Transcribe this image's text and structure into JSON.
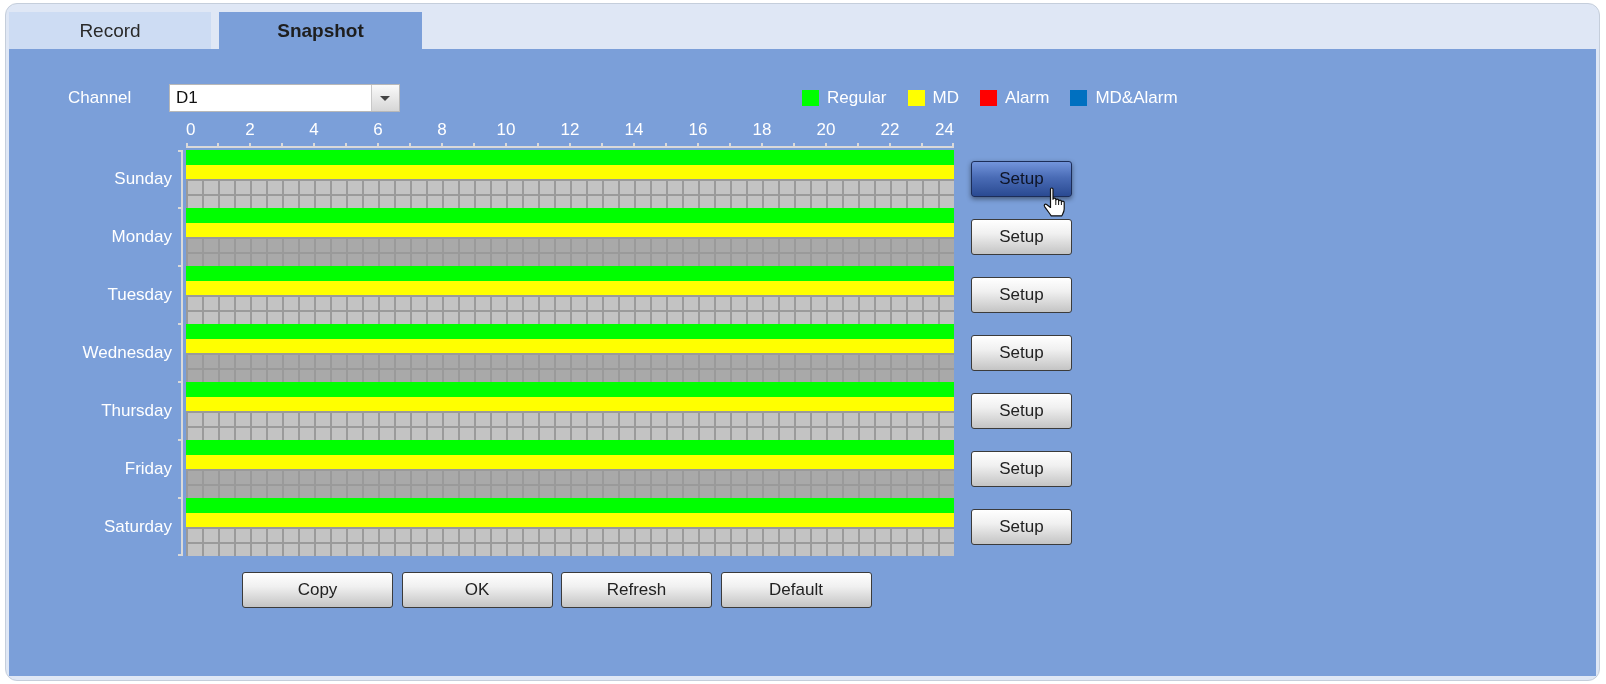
{
  "tabs": [
    {
      "label": "Record",
      "selected": false
    },
    {
      "label": "Snapshot",
      "selected": true
    }
  ],
  "channel": {
    "label": "Channel",
    "value": "D1"
  },
  "legend": [
    {
      "label": "Regular",
      "color": "#00ff00"
    },
    {
      "label": "MD",
      "color": "#ffff00"
    },
    {
      "label": "Alarm",
      "color": "#ff0000"
    },
    {
      "label": "MD&Alarm",
      "color": "#0070c0"
    }
  ],
  "hour_labels": [
    "0",
    "2",
    "4",
    "6",
    "8",
    "10",
    "12",
    "14",
    "16",
    "18",
    "20",
    "22",
    "24"
  ],
  "days": [
    {
      "name": "Sunday",
      "tracks": [
        {
          "on": true
        },
        {
          "on": true
        },
        {
          "on": false
        },
        {
          "on": false
        }
      ],
      "setup": {
        "label": "Setup",
        "hovered": true
      }
    },
    {
      "name": "Monday",
      "tracks": [
        {
          "on": true
        },
        {
          "on": true
        },
        {
          "on": false
        },
        {
          "on": false
        }
      ],
      "setup": {
        "label": "Setup",
        "hovered": false
      }
    },
    {
      "name": "Tuesday",
      "tracks": [
        {
          "on": true
        },
        {
          "on": true
        },
        {
          "on": false
        },
        {
          "on": false
        }
      ],
      "setup": {
        "label": "Setup",
        "hovered": false
      }
    },
    {
      "name": "Wednesday",
      "tracks": [
        {
          "on": true
        },
        {
          "on": true
        },
        {
          "on": false
        },
        {
          "on": false
        }
      ],
      "setup": {
        "label": "Setup",
        "hovered": false
      }
    },
    {
      "name": "Thursday",
      "tracks": [
        {
          "on": true
        },
        {
          "on": true
        },
        {
          "on": false
        },
        {
          "on": false
        }
      ],
      "setup": {
        "label": "Setup",
        "hovered": false
      }
    },
    {
      "name": "Friday",
      "tracks": [
        {
          "on": true
        },
        {
          "on": true
        },
        {
          "on": false
        },
        {
          "on": false
        }
      ],
      "setup": {
        "label": "Setup",
        "hovered": false
      }
    },
    {
      "name": "Saturday",
      "tracks": [
        {
          "on": true
        },
        {
          "on": true
        },
        {
          "on": false
        },
        {
          "on": false
        }
      ],
      "setup": {
        "label": "Setup",
        "hovered": false
      }
    }
  ],
  "buttons": [
    "Copy",
    "OK",
    "Refresh",
    "Default"
  ]
}
